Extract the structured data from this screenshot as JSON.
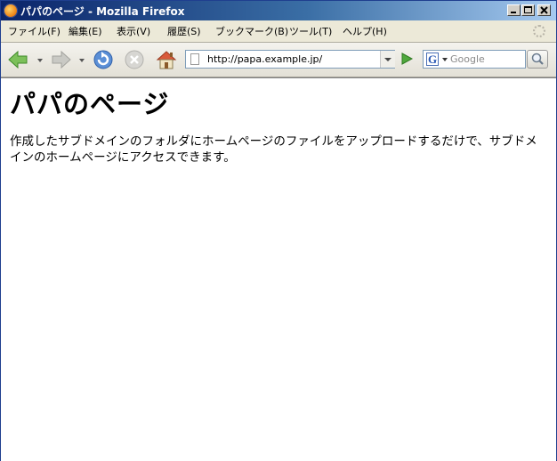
{
  "window": {
    "title": "パパのページ - Mozilla Firefox"
  },
  "menu": {
    "items": [
      {
        "label": "ファイル(F)"
      },
      {
        "label": "編集(E)"
      },
      {
        "label": "表示(V)"
      },
      {
        "label": "履歴(S)"
      },
      {
        "label": "ブックマーク(B)"
      },
      {
        "label": "ツール(T)"
      },
      {
        "label": "ヘルプ(H)"
      }
    ]
  },
  "toolbar": {
    "url": "http://papa.example.jp/",
    "search_placeholder": "Google",
    "search_engine_letter": "G",
    "icons": [
      "back-icon",
      "forward-icon",
      "reload-icon",
      "stop-icon",
      "home-icon",
      "page-icon",
      "go-icon",
      "search-icon"
    ]
  },
  "page": {
    "heading": "パパのページ",
    "paragraph": "作成したサブドメインのフォルダにホームページのファイルをアップロードするだけで、サブドメインのホームページにアクセスできます。"
  },
  "colors": {
    "titlebar_start": "#0a246a",
    "titlebar_end": "#a6caf0",
    "chrome": "#ece9d8",
    "url_border": "#7f9db9"
  }
}
